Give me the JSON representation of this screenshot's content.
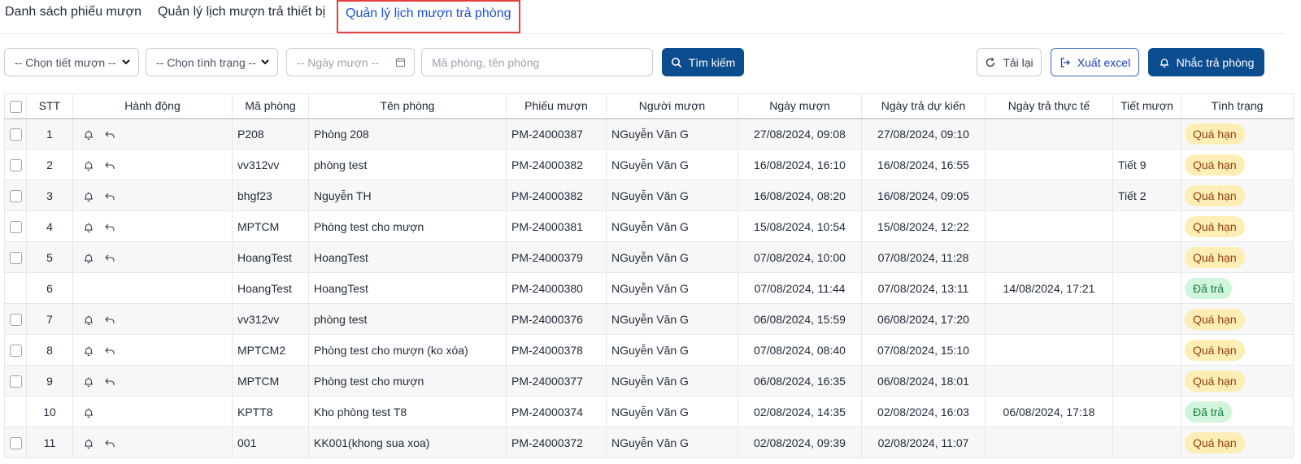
{
  "tabs": [
    {
      "label": "Danh sách phiếu mượn"
    },
    {
      "label": "Quản lý lịch mượn trả thiết bị"
    },
    {
      "label": "Quản lý lịch mượn trả phòng"
    }
  ],
  "filters": {
    "period_select": "-- Chọn tiết mượn --",
    "status_select": "-- Chọn tình trạng --",
    "date_placeholder": "-- Ngày mượn --",
    "search_placeholder": "Mã phòng, tên phòng",
    "search_button": "Tìm kiếm",
    "reload_button": "Tải lại",
    "export_button": "Xuất excel",
    "remind_button": "Nhắc trả phòng"
  },
  "table": {
    "headers": [
      "STT",
      "Hành động",
      "Mã phòng",
      "Tên phòng",
      "Phiếu mượn",
      "Người mượn",
      "Ngày mượn",
      "Ngày trả dự kiến",
      "Ngày trả thực tế",
      "Tiết mượn",
      "Tình trạng"
    ],
    "rows": [
      {
        "stt": "1",
        "checkbox": true,
        "actions": [
          "bell",
          "return"
        ],
        "room_code": "P208",
        "room_name": "Phòng 208",
        "ticket": "PM-24000387",
        "borrower": "NGuyễn Văn G",
        "borrow_date": "27/08/2024, 09:08",
        "expected_return": "27/08/2024, 09:10",
        "actual_return": "",
        "period": "",
        "status": "Quá hạn",
        "status_type": "overdue"
      },
      {
        "stt": "2",
        "checkbox": true,
        "actions": [
          "bell",
          "return"
        ],
        "room_code": "vv312vv",
        "room_name": "phòng test",
        "ticket": "PM-24000382",
        "borrower": "NGuyễn Văn G",
        "borrow_date": "16/08/2024, 16:10",
        "expected_return": "16/08/2024, 16:55",
        "actual_return": "",
        "period": "Tiết 9",
        "status": "Quá hạn",
        "status_type": "overdue"
      },
      {
        "stt": "3",
        "checkbox": true,
        "actions": [
          "bell",
          "return"
        ],
        "room_code": "bhgf23",
        "room_name": "Nguyễn TH",
        "ticket": "PM-24000382",
        "borrower": "NGuyễn Văn G",
        "borrow_date": "16/08/2024, 08:20",
        "expected_return": "16/08/2024, 09:05",
        "actual_return": "",
        "period": "Tiết 2",
        "status": "Quá hạn",
        "status_type": "overdue"
      },
      {
        "stt": "4",
        "checkbox": true,
        "actions": [
          "bell",
          "return"
        ],
        "room_code": "MPTCM",
        "room_name": "Phòng test cho mượn",
        "ticket": "PM-24000381",
        "borrower": "NGuyễn Văn G",
        "borrow_date": "15/08/2024, 10:54",
        "expected_return": "15/08/2024, 12:22",
        "actual_return": "",
        "period": "",
        "status": "Quá hạn",
        "status_type": "overdue"
      },
      {
        "stt": "5",
        "checkbox": true,
        "actions": [
          "bell",
          "return"
        ],
        "room_code": "HoangTest",
        "room_name": "HoangTest",
        "ticket": "PM-24000379",
        "borrower": "NGuyễn Văn G",
        "borrow_date": "07/08/2024, 10:00",
        "expected_return": "07/08/2024, 11:28",
        "actual_return": "",
        "period": "",
        "status": "Quá hạn",
        "status_type": "overdue"
      },
      {
        "stt": "6",
        "checkbox": false,
        "actions": [],
        "room_code": "HoangTest",
        "room_name": "HoangTest",
        "ticket": "PM-24000380",
        "borrower": "NGuyễn Văn G",
        "borrow_date": "07/08/2024, 11:44",
        "expected_return": "07/08/2024, 13:11",
        "actual_return": "14/08/2024, 17:21",
        "period": "",
        "status": "Đã trả",
        "status_type": "returned"
      },
      {
        "stt": "7",
        "checkbox": true,
        "actions": [
          "bell",
          "return"
        ],
        "room_code": "vv312vv",
        "room_name": "phòng test",
        "ticket": "PM-24000376",
        "borrower": "NGuyễn Văn G",
        "borrow_date": "06/08/2024, 15:59",
        "expected_return": "06/08/2024, 17:20",
        "actual_return": "",
        "period": "",
        "status": "Quá hạn",
        "status_type": "overdue"
      },
      {
        "stt": "8",
        "checkbox": true,
        "actions": [
          "bell",
          "return"
        ],
        "room_code": "MPTCM2",
        "room_name": "Phòng test cho mượn (ko xóa)",
        "ticket": "PM-24000378",
        "borrower": "NGuyễn Văn G",
        "borrow_date": "07/08/2024, 08:40",
        "expected_return": "07/08/2024, 15:10",
        "actual_return": "",
        "period": "",
        "status": "Quá hạn",
        "status_type": "overdue"
      },
      {
        "stt": "9",
        "checkbox": true,
        "actions": [
          "bell",
          "return"
        ],
        "room_code": "MPTCM",
        "room_name": "Phòng test cho mượn",
        "ticket": "PM-24000377",
        "borrower": "NGuyễn Văn G",
        "borrow_date": "06/08/2024, 16:35",
        "expected_return": "06/08/2024, 18:01",
        "actual_return": "",
        "period": "",
        "status": "Quá hạn",
        "status_type": "overdue"
      },
      {
        "stt": "10",
        "checkbox": false,
        "actions": [
          "bell"
        ],
        "room_code": "KPTT8",
        "room_name": "Kho phòng test T8",
        "ticket": "PM-24000374",
        "borrower": "NGuyễn Văn G",
        "borrow_date": "02/08/2024, 14:35",
        "expected_return": "02/08/2024, 16:03",
        "actual_return": "06/08/2024, 17:18",
        "period": "",
        "status": "Đã trả",
        "status_type": "returned"
      },
      {
        "stt": "11",
        "checkbox": true,
        "actions": [
          "bell",
          "return"
        ],
        "room_code": "001",
        "room_name": "KK001(khong sua xoa)",
        "ticket": "PM-24000372",
        "borrower": "NGuyễn Văn G",
        "borrow_date": "02/08/2024, 09:39",
        "expected_return": "02/08/2024, 11:07",
        "actual_return": "",
        "period": "",
        "status": "Quá hạn",
        "status_type": "overdue"
      }
    ]
  },
  "colors": {
    "primary": "#0b4d8f",
    "active_tab": "#1d4ed8",
    "highlight_border": "#e53e3e",
    "overdue_bg": "#fdeeb5",
    "returned_bg": "#d1f5dc"
  }
}
